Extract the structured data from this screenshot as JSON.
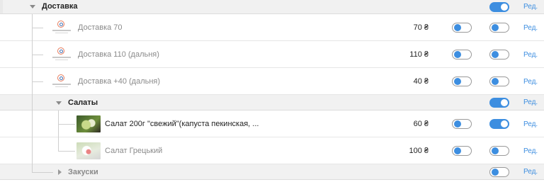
{
  "groups": {
    "delivery": {
      "label": "Доставка",
      "expanded": true,
      "enabled": true,
      "edit_label": "Ред."
    },
    "salads": {
      "label": "Салаты",
      "expanded": true,
      "enabled": true,
      "edit_label": "Ред."
    },
    "snacks": {
      "label": "Закуски",
      "expanded": false,
      "enabled": false,
      "edit_label": "Ред."
    }
  },
  "items": [
    {
      "name": "Доставка 70",
      "price": "70 ₴",
      "toggle_a": false,
      "toggle_b": false,
      "edit_label": "Ред.",
      "thumb": "logo",
      "name_style": "muted"
    },
    {
      "name": "Доставка 110 (дальня)",
      "price": "110 ₴",
      "toggle_a": false,
      "toggle_b": false,
      "edit_label": "Ред.",
      "thumb": "logo",
      "name_style": "muted"
    },
    {
      "name": "Доставка +40 (дальня)",
      "price": "40 ₴",
      "toggle_a": false,
      "toggle_b": false,
      "edit_label": "Ред.",
      "thumb": "logo",
      "name_style": "muted"
    },
    {
      "name": "Салат 200г \"свежий\"(капуста пекинская, ...",
      "price": "60 ₴",
      "toggle_a": false,
      "toggle_b": true,
      "edit_label": "Ред.",
      "thumb": "salad-photo",
      "name_style": "dark"
    },
    {
      "name": "Салат Грецький",
      "price": "100 ₴",
      "toggle_a": false,
      "toggle_b": false,
      "edit_label": "Ред.",
      "thumb": "salad-photo-faded",
      "name_style": "muted"
    }
  ],
  "colors": {
    "accent": "#3d8ee0",
    "group_bg": "#f1f1f1",
    "muted_text": "#8a8a8a"
  }
}
